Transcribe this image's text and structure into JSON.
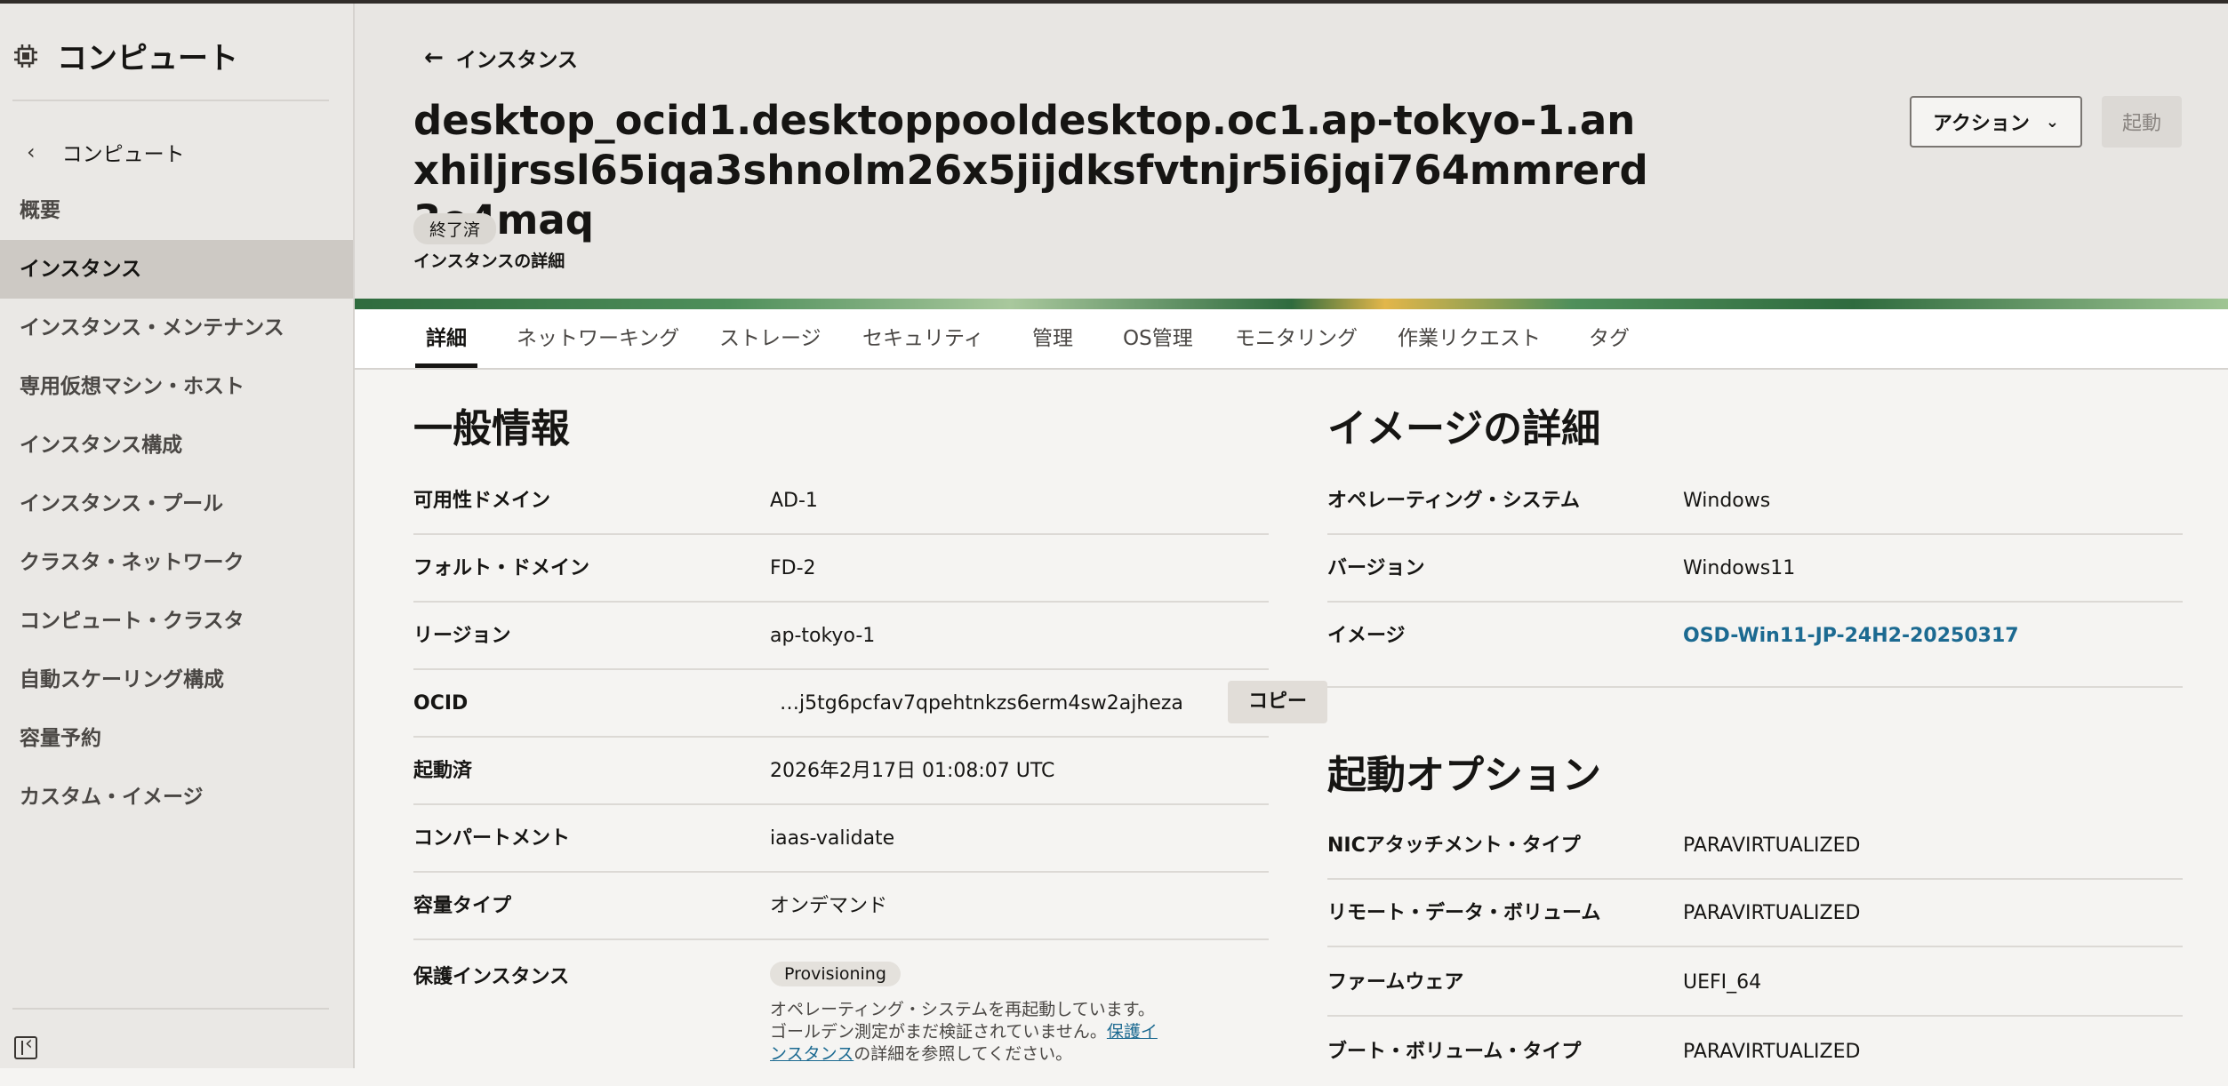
{
  "sidebar": {
    "title": "コンピュート",
    "back_label": "コンピュート",
    "items": [
      {
        "label": "概要"
      },
      {
        "label": "インスタンス"
      },
      {
        "label": "インスタンス・メンテナンス"
      },
      {
        "label": "専用仮想マシン・ホスト"
      },
      {
        "label": "インスタンス構成"
      },
      {
        "label": "インスタンス・プール"
      },
      {
        "label": "クラスタ・ネットワーク"
      },
      {
        "label": "コンピュート・クラスタ"
      },
      {
        "label": "自動スケーリング構成"
      },
      {
        "label": "容量予約"
      },
      {
        "label": "カスタム・イメージ"
      }
    ]
  },
  "header": {
    "breadcrumb": "インスタンス",
    "title": "desktop_ocid1.desktoppooldesktop.oc1.ap-tokyo-1.anxhiljrssl65iqa3shnolm26x5jijdksfvtnjr5i6jqi764mmrerd3o4maq",
    "status": "終了済",
    "subtitle": "インスタンスの詳細",
    "actions_label": "アクション",
    "launch_label": "起動"
  },
  "tabs": [
    {
      "label": "詳細"
    },
    {
      "label": "ネットワーキング"
    },
    {
      "label": "ストレージ"
    },
    {
      "label": "セキュリティ"
    },
    {
      "label": "管理"
    },
    {
      "label": "OS管理"
    },
    {
      "label": "モニタリング"
    },
    {
      "label": "作業リクエスト"
    },
    {
      "label": "タグ"
    }
  ],
  "general": {
    "heading": "一般情報",
    "rows": [
      {
        "key": "可用性ドメイン",
        "value": "AD-1"
      },
      {
        "key": "フォルト・ドメイン",
        "value": "FD-2"
      },
      {
        "key": "リージョン",
        "value": "ap-tokyo-1"
      },
      {
        "key": "OCID",
        "value": "…j5tg6pcfav7qpehtnkzs6erm4sw2ajheza",
        "copy": "コピー"
      },
      {
        "key": "起動済",
        "value": "2026年2月17日 01:08:07 UTC"
      },
      {
        "key": "コンパートメント",
        "value": "iaas-validate"
      },
      {
        "key": "容量タイプ",
        "value": "オンデマンド"
      },
      {
        "key": "保護インスタンス",
        "value": "Provisioning"
      }
    ],
    "note_pre": "オペレーティング・システムを再起動しています。ゴールデン測定がまだ検証されていません。",
    "note_link": "保護インスタンス",
    "note_post": "の詳細を参照してください。"
  },
  "image": {
    "heading": "イメージの詳細",
    "rows": [
      {
        "key": "オペレーティング・システム",
        "value": "Windows"
      },
      {
        "key": "バージョン",
        "value": "Windows11"
      },
      {
        "key": "イメージ",
        "value": "OSD-Win11-JP-24H2-20250317"
      }
    ]
  },
  "launch_options": {
    "heading": "起動オプション",
    "rows": [
      {
        "key": "NICアタッチメント・タイプ",
        "value": "PARAVIRTUALIZED"
      },
      {
        "key": "リモート・データ・ボリューム",
        "value": "PARAVIRTUALIZED"
      },
      {
        "key": "ファームウェア",
        "value": "UEFI_64"
      },
      {
        "key": "ブート・ボリューム・タイプ",
        "value": "PARAVIRTUALIZED"
      }
    ]
  }
}
